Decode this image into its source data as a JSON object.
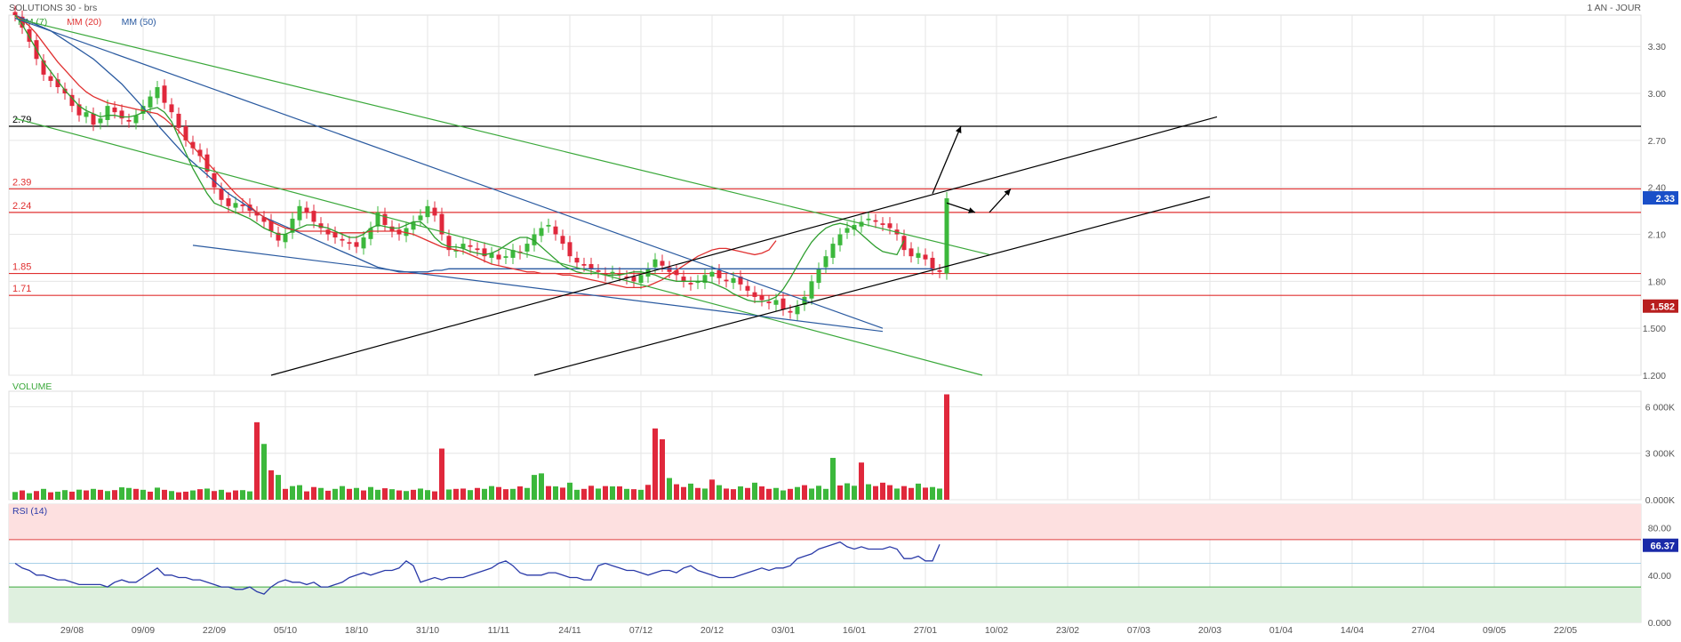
{
  "header": {
    "title": "SOLUTIONS 30 - brs",
    "period": "1 AN - JOUR",
    "legend": [
      {
        "label": "MM (7)",
        "color": "#2e9e2e"
      },
      {
        "label": "MM (20)",
        "color": "#e03030"
      },
      {
        "label": "MM (50)",
        "color": "#2a5aa0"
      }
    ]
  },
  "colors": {
    "up": "#3cb83c",
    "down": "#e0283c",
    "grid": "#e6e6e6",
    "level": "#e03030"
  },
  "chart_data": [
    {
      "type": "candlestick",
      "name": "price",
      "ylim": [
        1.2,
        3.5
      ],
      "yticks": [
        {
          "value": 3.3,
          "label": "3.30"
        },
        {
          "value": 3.0,
          "label": "3.00"
        },
        {
          "value": 2.7,
          "label": "2.70"
        },
        {
          "value": 2.4,
          "label": "2.40"
        },
        {
          "value": 2.1,
          "label": "2.10"
        },
        {
          "value": 1.8,
          "label": "1.80"
        },
        {
          "value": 1.5,
          "label": "1.500"
        },
        {
          "value": 1.2,
          "label": "1.200"
        }
      ],
      "xticks": [
        "29/08",
        "09/09",
        "22/09",
        "05/10",
        "18/10",
        "31/10",
        "11/11",
        "24/11",
        "07/12",
        "20/12",
        "03/01",
        "16/01",
        "27/01",
        "10/02",
        "23/02",
        "07/03",
        "20/03",
        "01/04",
        "14/04",
        "27/04",
        "09/05",
        "22/05"
      ],
      "xtick_index": [
        10,
        20,
        30,
        40,
        50,
        60,
        70,
        80,
        90,
        100,
        110,
        120,
        130,
        140,
        150,
        160,
        170,
        180,
        190,
        200,
        210,
        220
      ],
      "x_range": [
        0,
        225
      ],
      "levels": [
        {
          "value": 2.79,
          "label": "2.79",
          "color": "#000000"
        },
        {
          "value": 2.39,
          "label": "2.39",
          "color": "#e03030"
        },
        {
          "value": 2.24,
          "label": "2.24",
          "color": "#e03030"
        },
        {
          "value": 1.85,
          "label": "1.85",
          "color": "#e03030"
        },
        {
          "value": 1.71,
          "label": "1.71",
          "color": "#e03030"
        }
      ],
      "last_price": {
        "value": 2.33,
        "label": "2.33"
      },
      "marker": {
        "value": 1.582,
        "label": "1.582"
      },
      "closes": [
        3.5,
        3.42,
        3.33,
        3.22,
        3.12,
        3.08,
        3.04,
        3.0,
        2.92,
        2.86,
        2.88,
        2.8,
        2.84,
        2.92,
        2.88,
        2.84,
        2.82,
        2.86,
        2.92,
        2.98,
        3.04,
        2.94,
        2.88,
        2.78,
        2.7,
        2.65,
        2.6,
        2.5,
        2.4,
        2.32,
        2.28,
        2.3,
        2.28,
        2.25,
        2.22,
        2.18,
        2.12,
        2.06,
        2.1,
        2.2,
        2.28,
        2.24,
        2.18,
        2.14,
        2.1,
        2.08,
        2.06,
        2.04,
        2.02,
        2.08,
        2.14,
        2.24,
        2.16,
        2.12,
        2.1,
        2.14,
        2.18,
        2.22,
        2.28,
        2.22,
        2.1,
        2.0,
        2.0,
        2.04,
        2.02,
        2.0,
        1.96,
        1.98,
        1.94,
        1.96,
        2.0,
        1.98,
        2.04,
        2.1,
        2.14,
        2.16,
        2.1,
        2.04,
        1.96,
        1.92,
        1.9,
        1.88,
        1.86,
        1.84,
        1.86,
        1.84,
        1.82,
        1.8,
        1.84,
        1.88,
        1.94,
        1.9,
        1.86,
        1.84,
        1.8,
        1.78,
        1.8,
        1.84,
        1.86,
        1.82,
        1.8,
        1.82,
        1.78,
        1.74,
        1.7,
        1.68,
        1.66,
        1.68,
        1.62,
        1.6,
        1.64,
        1.7,
        1.8,
        1.88,
        1.96,
        2.04,
        2.1,
        2.14,
        2.16,
        2.18,
        2.2,
        2.18,
        2.16,
        2.14,
        2.1,
        2.0,
        1.96,
        1.98,
        1.94,
        1.88,
        1.86,
        2.33
      ],
      "ma7": [
        3.5,
        3.44,
        3.36,
        3.28,
        3.2,
        3.14,
        3.08,
        3.02,
        2.97,
        2.92,
        2.89,
        2.87,
        2.85,
        2.86,
        2.86,
        2.85,
        2.85,
        2.86,
        2.88,
        2.9,
        2.91,
        2.88,
        2.82,
        2.72,
        2.62,
        2.52,
        2.44,
        2.36,
        2.3,
        2.28,
        2.26,
        2.24,
        2.22,
        2.2,
        2.17,
        2.14,
        2.12,
        2.1,
        2.1,
        2.12,
        2.14,
        2.16,
        2.16,
        2.15,
        2.14,
        2.12,
        2.1,
        2.08,
        2.08,
        2.1,
        2.14,
        2.16,
        2.15,
        2.14,
        2.14,
        2.16,
        2.18,
        2.18,
        2.14,
        2.08,
        2.04,
        2.02,
        2.02,
        2.01,
        1.99,
        1.98,
        1.97,
        1.98,
        2.0,
        2.03,
        2.06,
        2.08,
        2.08,
        2.06,
        2.02,
        1.98,
        1.94,
        1.9,
        1.88,
        1.86,
        1.85,
        1.85,
        1.85,
        1.84,
        1.84,
        1.84,
        1.85,
        1.86,
        1.86,
        1.85,
        1.84,
        1.82,
        1.81,
        1.8,
        1.8,
        1.8,
        1.8,
        1.8,
        1.79,
        1.77,
        1.75,
        1.72,
        1.7,
        1.68,
        1.67,
        1.67,
        1.68,
        1.7,
        1.75,
        1.82,
        1.9,
        1.98,
        2.05,
        2.1,
        2.14,
        2.16,
        2.17,
        2.16,
        2.14,
        2.1,
        2.06,
        2.02,
        1.99,
        1.98,
        1.97,
        2.06
      ],
      "ma20": [
        3.5,
        3.47,
        3.43,
        3.38,
        3.32,
        3.26,
        3.2,
        3.15,
        3.1,
        3.05,
        3.01,
        2.98,
        2.96,
        2.94,
        2.93,
        2.92,
        2.91,
        2.9,
        2.89,
        2.88,
        2.87,
        2.84,
        2.8,
        2.76,
        2.71,
        2.66,
        2.61,
        2.56,
        2.51,
        2.46,
        2.41,
        2.36,
        2.32,
        2.28,
        2.24,
        2.21,
        2.18,
        2.16,
        2.14,
        2.13,
        2.12,
        2.12,
        2.12,
        2.12,
        2.12,
        2.11,
        2.11,
        2.11,
        2.11,
        2.11,
        2.12,
        2.12,
        2.12,
        2.12,
        2.12,
        2.11,
        2.1,
        2.08,
        2.06,
        2.04,
        2.02,
        2.01,
        2.0,
        1.99,
        1.97,
        1.95,
        1.93,
        1.91,
        1.9,
        1.89,
        1.88,
        1.87,
        1.86,
        1.86,
        1.85,
        1.85,
        1.85,
        1.84,
        1.84,
        1.83,
        1.82,
        1.81,
        1.8,
        1.79,
        1.78,
        1.77,
        1.76,
        1.76,
        1.76,
        1.77,
        1.79,
        1.81,
        1.84,
        1.87,
        1.9,
        1.93,
        1.96,
        1.98,
        2.0,
        2.01,
        2.01,
        2.0,
        1.99,
        1.98,
        1.97,
        1.98,
        2.0,
        2.06
      ],
      "ma50": [
        3.5,
        3.48,
        3.46,
        3.44,
        3.42,
        3.4,
        3.37,
        3.34,
        3.31,
        3.28,
        3.25,
        3.22,
        3.18,
        3.14,
        3.1,
        3.06,
        3.01,
        2.96,
        2.91,
        2.86,
        2.8,
        2.75,
        2.7,
        2.65,
        2.6,
        2.56,
        2.52,
        2.48,
        2.44,
        2.4,
        2.36,
        2.33,
        2.3,
        2.27,
        2.24,
        2.21,
        2.19,
        2.17,
        2.15,
        2.13,
        2.11,
        2.09,
        2.07,
        2.05,
        2.03,
        2.01,
        1.99,
        1.97,
        1.95,
        1.93,
        1.91,
        1.89,
        1.88,
        1.87,
        1.86,
        1.86,
        1.86,
        1.86,
        1.86,
        1.87,
        1.87,
        1.88,
        1.88,
        1.88,
        1.88,
        1.88,
        1.88,
        1.88,
        1.88,
        1.88,
        1.88,
        1.88,
        1.88,
        1.88,
        1.88,
        1.88,
        1.88,
        1.88,
        1.88,
        1.88,
        1.88,
        1.88,
        1.88,
        1.88,
        1.88,
        1.88,
        1.88,
        1.88,
        1.88,
        1.88,
        1.88,
        1.88,
        1.88,
        1.88,
        1.88,
        1.88,
        1.88,
        1.88,
        1.88,
        1.88,
        1.88,
        1.88,
        1.88,
        1.88,
        1.88,
        1.88,
        1.88,
        1.88,
        1.88,
        1.88,
        1.88,
        1.88,
        1.88,
        1.88,
        1.88,
        1.88,
        1.88,
        1.88,
        1.88,
        1.88,
        1.88,
        1.88,
        1.88,
        1.88,
        1.88,
        1.88,
        1.88,
        1.88,
        1.88,
        1.88
      ],
      "trendlines": [
        {
          "from": [
            0,
            3.48
          ],
          "to": [
            137,
            1.97
          ],
          "color": "#3aa83a"
        },
        {
          "from": [
            0,
            2.84
          ],
          "to": [
            136,
            1.2
          ],
          "color": "#3aa83a"
        },
        {
          "from": [
            25,
            2.03
          ],
          "to": [
            122,
            1.48
          ],
          "color": "#2a5aa0"
        },
        {
          "from": [
            0,
            3.48
          ],
          "to": [
            122,
            1.5
          ],
          "color": "#2a5aa0"
        },
        {
          "from": [
            36,
            1.2
          ],
          "to": [
            169,
            2.85
          ],
          "color": "#000000"
        },
        {
          "from": [
            73,
            1.2
          ],
          "to": [
            168,
            2.34
          ],
          "color": "#000000"
        }
      ],
      "arrows": [
        {
          "from": [
            129,
            2.36
          ],
          "to": [
            133,
            2.79
          ]
        },
        {
          "from": [
            131,
            2.3
          ],
          "to": [
            135,
            2.24
          ]
        },
        {
          "from": [
            137,
            2.24
          ],
          "to": [
            140,
            2.39
          ]
        }
      ]
    },
    {
      "type": "bar",
      "name": "VOLUME",
      "title": "VOLUME",
      "ylim": [
        0,
        7000
      ],
      "yticks": [
        {
          "value": 0,
          "label": "0.000K"
        },
        {
          "value": 3000,
          "label": "3 000K"
        },
        {
          "value": 6000,
          "label": "6 000K"
        }
      ],
      "values": [
        500,
        600,
        420,
        560,
        700,
        480,
        520,
        620,
        520,
        650,
        600,
        700,
        640,
        560,
        620,
        800,
        760,
        700,
        640,
        520,
        780,
        640,
        560,
        480,
        520,
        600,
        680,
        720,
        560,
        640,
        480,
        600,
        620,
        540,
        5000,
        3600,
        1900,
        1600,
        700,
        880,
        940,
        540,
        820,
        760,
        580,
        700,
        880,
        700,
        760,
        600,
        820,
        640,
        740,
        680,
        600,
        560,
        640,
        720,
        620,
        540,
        3300,
        660,
        700,
        720,
        620,
        760,
        700,
        880,
        820,
        680,
        700,
        860,
        760,
        1600,
        1700,
        880,
        860,
        780,
        1100,
        640,
        700,
        900,
        720,
        880,
        860,
        860,
        700,
        680,
        640,
        960,
        4600,
        3900,
        1400,
        1000,
        820,
        1040,
        760,
        720,
        1300,
        940,
        720,
        680,
        860,
        760,
        1100,
        860,
        700,
        760,
        600,
        700,
        820,
        940,
        720,
        900,
        700,
        2700,
        920,
        1060,
        900,
        2400,
        1000,
        880,
        1100,
        940,
        720,
        880,
        760,
        1040,
        780,
        820,
        720,
        6800
      ],
      "colors_up": [
        1,
        0,
        1,
        0,
        1,
        0,
        1,
        1,
        0,
        1,
        0,
        1,
        0,
        1,
        0,
        1,
        1,
        0,
        1,
        0,
        1,
        0,
        1,
        0,
        0,
        1,
        0,
        1,
        0,
        1,
        0,
        0,
        1,
        1,
        0,
        1,
        0,
        1,
        0,
        1,
        1,
        0,
        0,
        1,
        0,
        1,
        1,
        0,
        1,
        0,
        1,
        1,
        0,
        1,
        0,
        1,
        0,
        1,
        1,
        0,
        0,
        1,
        0,
        0,
        1,
        0,
        1,
        1,
        0,
        0,
        1,
        0,
        1,
        1,
        1,
        0,
        1,
        0,
        1,
        1,
        0,
        0,
        1,
        0,
        1,
        0,
        1,
        0,
        1,
        0,
        0,
        0,
        1,
        0,
        0,
        1,
        0,
        1,
        0,
        1,
        0,
        0,
        1,
        0,
        1,
        0,
        0,
        1,
        1,
        0,
        1,
        0,
        1,
        1,
        1,
        1,
        0,
        1,
        1,
        0,
        1,
        0,
        0,
        0,
        1,
        0,
        0,
        1,
        0,
        1,
        1
      ]
    },
    {
      "type": "line",
      "name": "RSI (14)",
      "title": "RSI (14)",
      "ylim": [
        0,
        100
      ],
      "yticks": [
        {
          "value": 0,
          "label": "0.000"
        },
        {
          "value": 40,
          "label": "40.00"
        },
        {
          "value": 80,
          "label": "80.00"
        }
      ],
      "bands": {
        "overbought": 70,
        "oversold": 30
      },
      "last_value": {
        "value": 66.37,
        "label": "66.37"
      },
      "values": [
        50,
        46,
        44,
        40,
        40,
        38,
        36,
        36,
        34,
        32,
        32,
        32,
        32,
        30,
        34,
        36,
        34,
        34,
        38,
        42,
        46,
        40,
        40,
        38,
        38,
        36,
        36,
        34,
        32,
        30,
        30,
        28,
        28,
        30,
        26,
        24,
        30,
        34,
        36,
        34,
        34,
        32,
        34,
        30,
        30,
        32,
        34,
        38,
        40,
        42,
        40,
        42,
        44,
        44,
        46,
        52,
        48,
        34,
        36,
        38,
        36,
        38,
        38,
        38,
        40,
        42,
        44,
        46,
        50,
        52,
        48,
        42,
        40,
        40,
        40,
        42,
        42,
        40,
        38,
        38,
        36,
        36,
        48,
        50,
        48,
        46,
        44,
        44,
        42,
        40,
        42,
        44,
        44,
        42,
        46,
        48,
        44,
        42,
        40,
        38,
        38,
        38,
        40,
        42,
        44,
        46,
        44,
        46,
        46,
        48,
        54,
        56,
        58,
        62,
        64,
        66,
        68,
        64,
        62,
        64,
        62,
        62,
        62,
        64,
        62,
        54,
        54,
        56,
        52,
        52,
        66
      ]
    }
  ]
}
